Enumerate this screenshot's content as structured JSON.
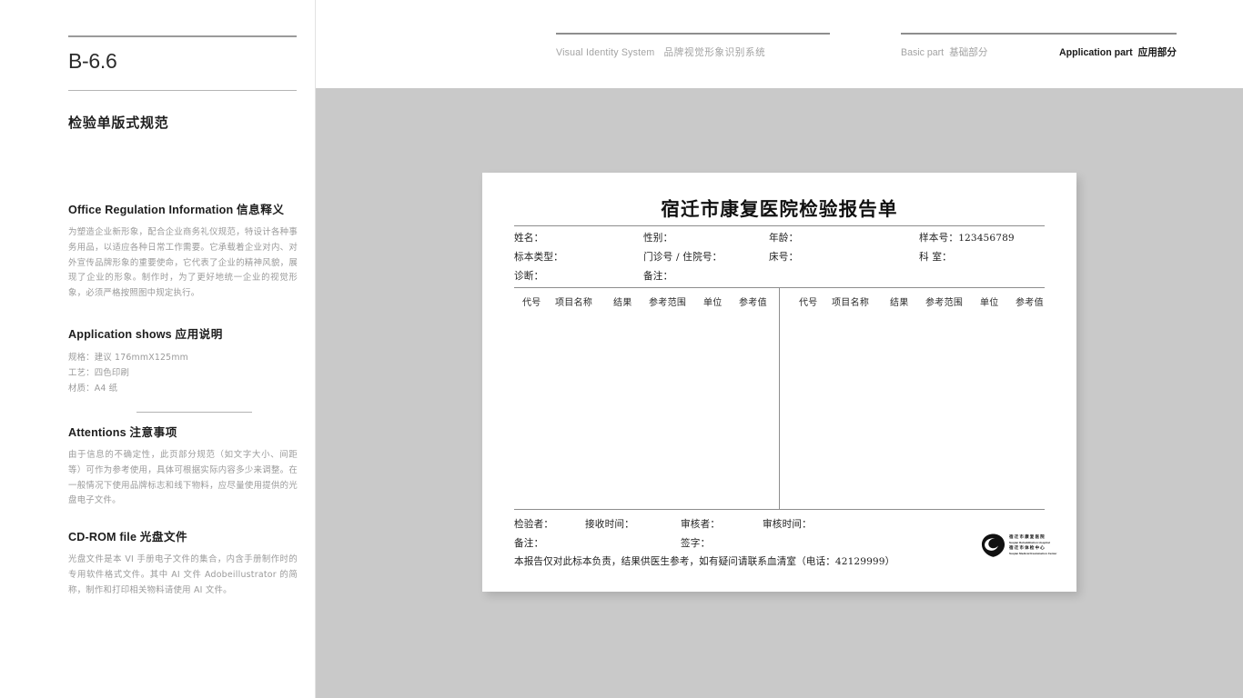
{
  "page": {
    "code": "B-6.6",
    "section_title": "检验单版式规范"
  },
  "header": {
    "vis_en": "Visual Identity System",
    "vis_cn": "品牌视觉形象识别系统",
    "basic_en": "Basic part",
    "basic_cn": "基础部分",
    "application_en": "Application part",
    "application_cn": "应用部分"
  },
  "sidebar": {
    "blocks": [
      {
        "title_en": "Office Regulation Information",
        "title_cn": "信息释义",
        "body": "为塑造企业新形象，配合企业商务礼仪规范，特设计各种事务用品，以适应各种日常工作需要。它承载着企业对内、对外宣传品牌形象的重要使命，它代表了企业的精神风貌，展现了企业的形象。制作时，为了更好地统一企业的视觉形象，必须严格按照图中规定执行。"
      },
      {
        "title_en": "Application shows",
        "title_cn": "应用说明",
        "specs": [
          "规格：建议 176mmX125mm",
          "工艺：四色印刷",
          "材质：A4 纸"
        ]
      },
      {
        "title_en": "Attentions",
        "title_cn": "注意事项",
        "body": "由于信息的不确定性，此页部分规范（如文字大小、间距等）可作为参考使用，具体可根据实际内容多少来调整。在一般情况下使用品牌标志和线下物料，应尽量使用提供的光盘电子文件。"
      },
      {
        "title_en": "CD-ROM file",
        "title_cn": "光盘文件",
        "body": "光盘文件是本 VI 手册电子文件的集合，内含手册制作时的专用软件格式文件。其中 AI 文件 Adobeillustrator 的简称，制作和打印相关物料请使用 AI 文件。"
      }
    ]
  },
  "report": {
    "title": "宿迁市康复医院检验报告单",
    "patient_fields": [
      {
        "label": "姓名：",
        "value": ""
      },
      {
        "label": "性别：",
        "value": ""
      },
      {
        "label": "年龄：",
        "value": ""
      },
      {
        "label": "样本号：",
        "value": "123456789"
      },
      {
        "label": "标本类型：",
        "value": ""
      },
      {
        "label": "门诊号 / 住院号：",
        "value": ""
      },
      {
        "label": "床号：",
        "value": ""
      },
      {
        "label": "科 室：",
        "value": ""
      },
      {
        "label": "诊断：",
        "value": ""
      },
      {
        "label": "备注：",
        "value": ""
      }
    ],
    "table": {
      "columns_left": [
        "代号",
        "项目名称",
        "结果",
        "参考范围",
        "单位",
        "参考值"
      ],
      "columns_right": [
        "代号",
        "项目名称",
        "结果",
        "参考范围",
        "单位",
        "参考值"
      ],
      "rows": []
    },
    "footer_fields": [
      {
        "label": "检验者："
      },
      {
        "label": "接收时间："
      },
      {
        "label": "审核者："
      },
      {
        "label": "审核时间："
      },
      {
        "label": "备注："
      },
      {
        "label": "签字："
      }
    ],
    "disclaimer": "本报告仅对此标本负责，结果供医生参考，如有疑问请联系血清室（电话：42129999）",
    "logo": {
      "line1_cn": "宿迁市康复医院",
      "line1_en": "Suqian Rehabilitation Hospital",
      "line2_cn": "宿迁市体检中心",
      "line2_en": "Suqian Medical Examination Center"
    }
  },
  "colors": {
    "panel_gray": "#c9c9c9",
    "rule_gray": "#a8a8a8",
    "body_text": "#9a9a9a",
    "heading": "#1d1d1d"
  }
}
